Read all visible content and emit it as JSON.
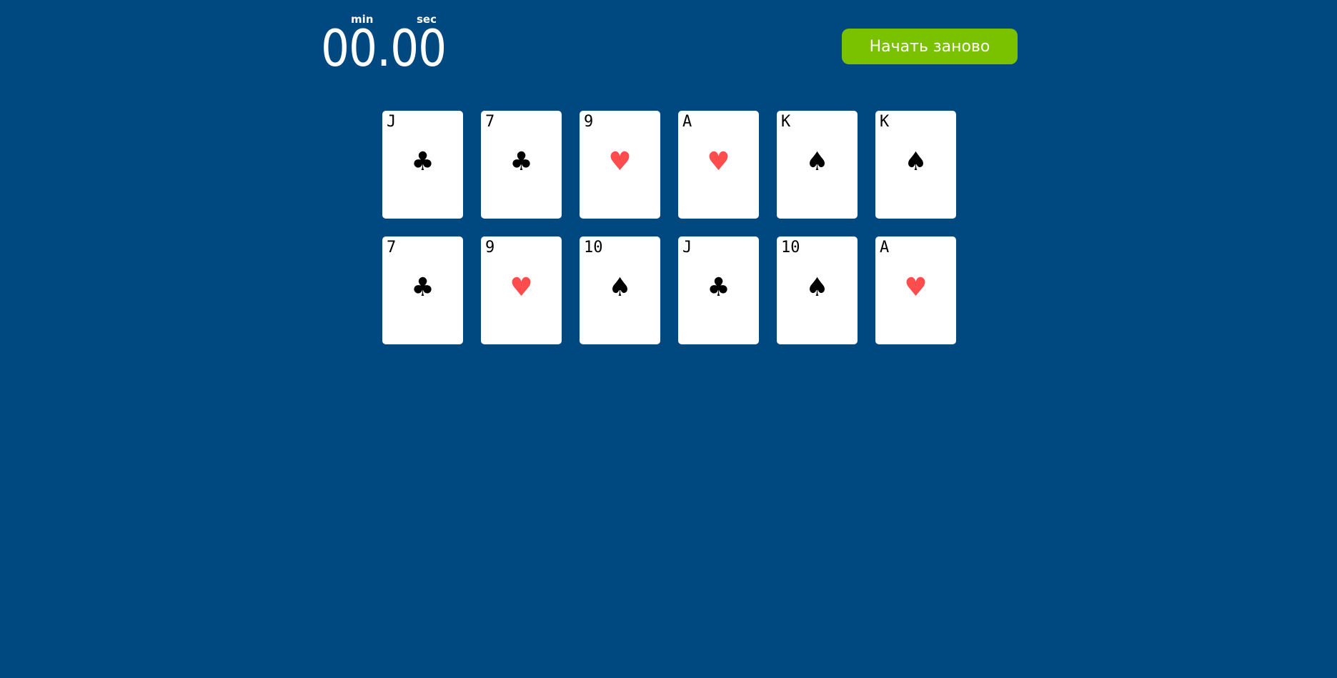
{
  "timer": {
    "min_label": "min",
    "sec_label": "sec",
    "value": "00.00"
  },
  "restart_button": {
    "label": "Начать заново",
    "color": "#7ac100"
  },
  "colors": {
    "background": "#004980",
    "red_suit": "#ff4d4d",
    "black_suit": "#000000"
  },
  "cards": [
    {
      "rank": "J",
      "suit": "♣",
      "suit_name": "clubs",
      "color": "#000000"
    },
    {
      "rank": "7",
      "suit": "♣",
      "suit_name": "clubs",
      "color": "#000000"
    },
    {
      "rank": "9",
      "suit": "♥",
      "suit_name": "hearts",
      "color": "#ff4d4d"
    },
    {
      "rank": "A",
      "suit": "♥",
      "suit_name": "hearts",
      "color": "#ff4d4d"
    },
    {
      "rank": "K",
      "suit": "♠",
      "suit_name": "spades",
      "color": "#000000"
    },
    {
      "rank": "K",
      "suit": "♠",
      "suit_name": "spades",
      "color": "#000000"
    },
    {
      "rank": "7",
      "suit": "♣",
      "suit_name": "clubs",
      "color": "#000000"
    },
    {
      "rank": "9",
      "suit": "♥",
      "suit_name": "hearts",
      "color": "#ff4d4d"
    },
    {
      "rank": "10",
      "suit": "♠",
      "suit_name": "spades",
      "color": "#000000"
    },
    {
      "rank": "J",
      "suit": "♣",
      "suit_name": "clubs",
      "color": "#000000"
    },
    {
      "rank": "10",
      "suit": "♠",
      "suit_name": "spades",
      "color": "#000000"
    },
    {
      "rank": "A",
      "suit": "♥",
      "suit_name": "hearts",
      "color": "#ff4d4d"
    }
  ]
}
